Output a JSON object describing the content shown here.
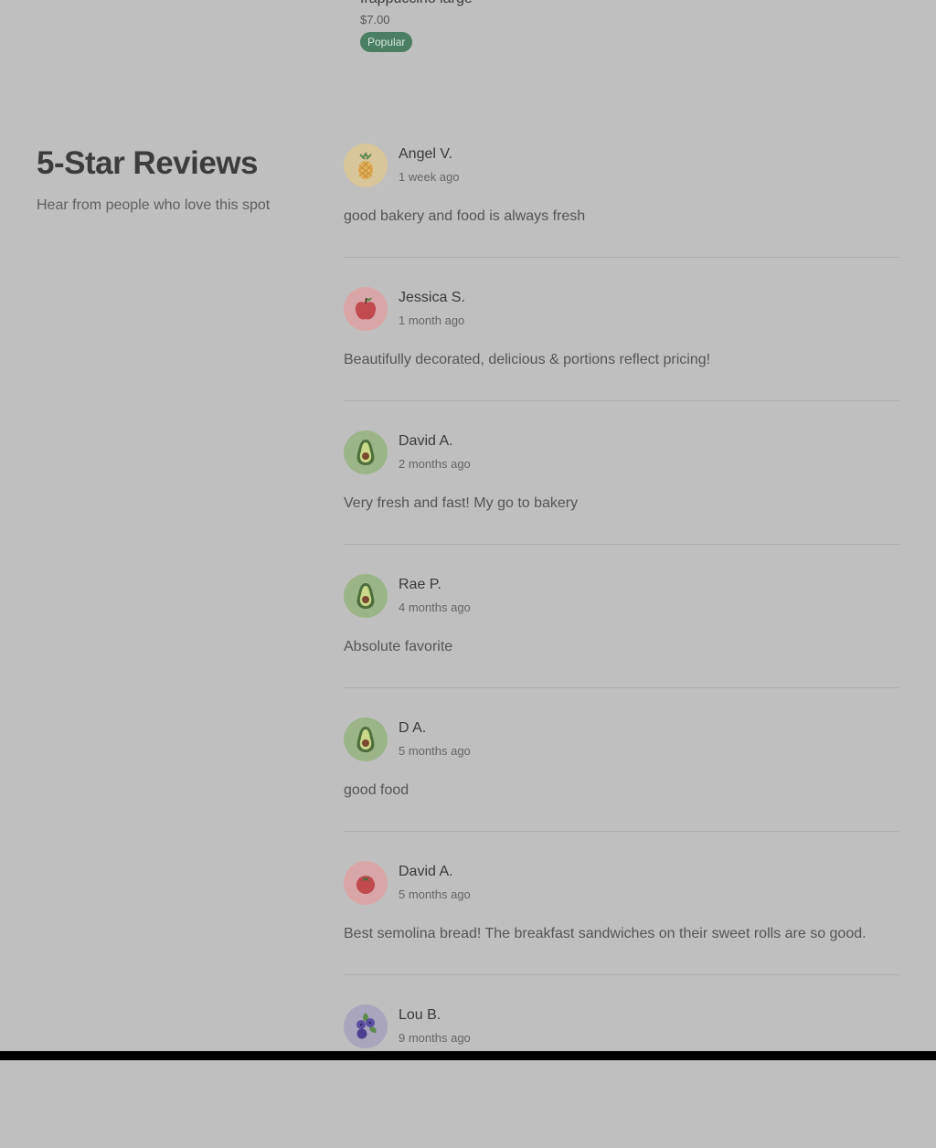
{
  "top_item": {
    "name": "frappuccino large",
    "price": "$7.00",
    "badge": "Popular"
  },
  "reviews_section": {
    "title": "5-Star Reviews",
    "subtitle": "Hear from people who love this spot"
  },
  "reviews": [
    {
      "author": "Angel V.",
      "when": "1 week ago",
      "text": "good bakery and food is always fresh",
      "avatar_icon": "pineapple-icon",
      "avatar_bg": "#d8c59a"
    },
    {
      "author": "Jessica S.",
      "when": "1 month ago",
      "text": "Beautifully decorated, delicious & portions reflect pricing!",
      "avatar_icon": "apple-icon",
      "avatar_bg": "#d9a6a8"
    },
    {
      "author": "David A.",
      "when": "2 months ago",
      "text": "Very fresh and fast! My go to bakery",
      "avatar_icon": "avocado-icon",
      "avatar_bg": "#9bb589"
    },
    {
      "author": "Rae P.",
      "when": "4 months ago",
      "text": "Absolute favorite",
      "avatar_icon": "avocado-icon",
      "avatar_bg": "#9bb589"
    },
    {
      "author": "D A.",
      "when": "5 months ago",
      "text": "good food",
      "avatar_icon": "avocado-icon",
      "avatar_bg": "#9bb589"
    },
    {
      "author": "David A.",
      "when": "5 months ago",
      "text": "Best semolina bread! The breakfast sandwiches on their sweet rolls are so good.",
      "avatar_icon": "tomato-icon",
      "avatar_bg": "#d9a6a8"
    },
    {
      "author": "Lou B.",
      "when": "9 months ago",
      "text": "",
      "avatar_icon": "blueberry-icon",
      "avatar_bg": "#a9a5bd"
    }
  ]
}
